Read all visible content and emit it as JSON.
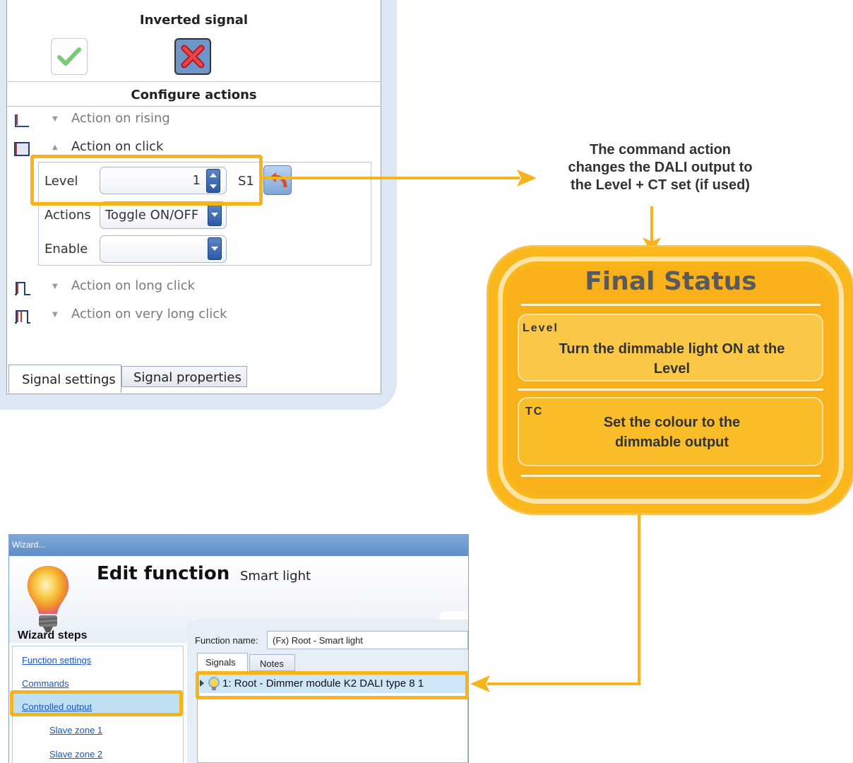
{
  "top_panel": {
    "inverted_signal": {
      "title": "Inverted signal",
      "check_icon": "checkmark-icon",
      "cross_icon": "red-x-icon"
    },
    "configure_actions": {
      "title": "Configure actions",
      "rows": [
        {
          "label": "Action on rising",
          "expanded": false
        },
        {
          "label": "Action on click",
          "expanded": true
        },
        {
          "label": "Action on long click",
          "expanded": false
        },
        {
          "label": "Action on very long click",
          "expanded": false
        }
      ],
      "level": {
        "label": "Level",
        "value": "1",
        "scene": "S1"
      },
      "actions": {
        "label": "Actions",
        "value": "Toggle ON/OFF"
      },
      "enable": {
        "label": "Enable",
        "value": ""
      }
    },
    "tabs": [
      "Signal settings",
      "Signal properties"
    ]
  },
  "annotation": {
    "lines": [
      "The command action",
      "changes the DALI output to",
      "the Level + CT set (if used)"
    ]
  },
  "final_status": {
    "title": "Final Status",
    "cards": [
      {
        "tag": "Level",
        "text_lines": [
          "Turn the dimmable light ON at the",
          "Level"
        ]
      },
      {
        "tag": "TC",
        "text_lines": [
          "Set the colour to the",
          "dimmable output"
        ]
      }
    ]
  },
  "wizard": {
    "window_title": "Wizard...",
    "heading": "Edit function",
    "subheading": "Smart light",
    "steps_title": "Wizard steps",
    "steps": [
      {
        "label": "Function settings",
        "indent": false,
        "selected": false
      },
      {
        "label": "Commands",
        "indent": false,
        "selected": false
      },
      {
        "label": "Controlled output",
        "indent": false,
        "selected": true
      },
      {
        "label": "Slave zone 1",
        "indent": true,
        "selected": false
      },
      {
        "label": "Slave zone 2",
        "indent": true,
        "selected": false
      }
    ],
    "function_name_label": "Function name:",
    "function_name_value": "(Fx) Root - Smart light",
    "tabs": [
      "Signals",
      "Notes"
    ],
    "signal_item": "1: Root - Dimmer module K2  DALI type 8 1"
  },
  "colors": {
    "highlight": "#f7b41a",
    "status_fill": "#f9b11a",
    "link": "#1a55c9"
  }
}
